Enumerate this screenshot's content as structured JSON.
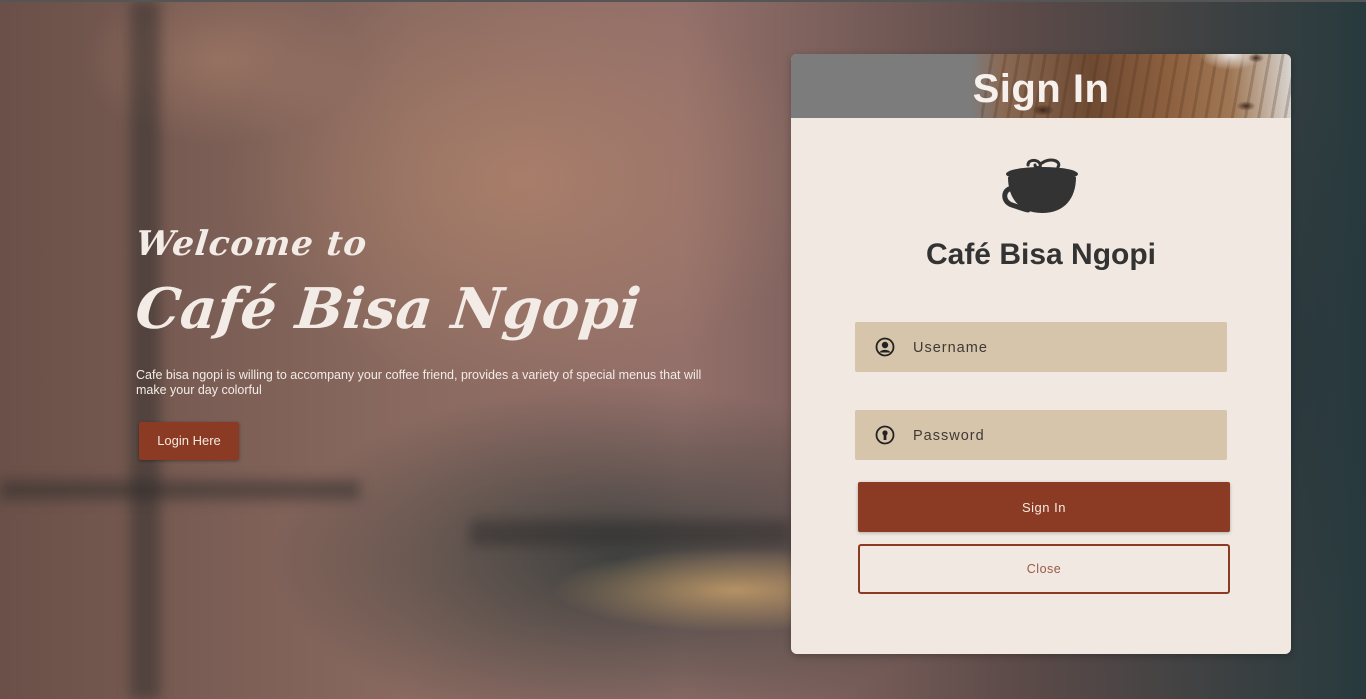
{
  "hero": {
    "welcome": "Welcome to",
    "brand": "Café Bisa Ngopi",
    "description": "Cafe bisa ngopi is willing to accompany your coffee friend, provides a variety of special menus that will make your day colorful",
    "login_button": "Login Here"
  },
  "login_card": {
    "title": "Sign In",
    "cafe_name": "Café Bisa Ngopi",
    "username": {
      "placeholder": "Username",
      "value": "",
      "icon": "user-circle-icon"
    },
    "password": {
      "placeholder": "Password",
      "value": "",
      "icon": "lock-circle-icon"
    },
    "signin_button": "Sign In",
    "close_button": "Close",
    "logo_icon": "coffee-cup-icon"
  },
  "colors": {
    "accent": "#8b3a24",
    "card_background": "#f0e8e1",
    "input_background": "#d6c4ab",
    "text_dark": "#333333"
  }
}
